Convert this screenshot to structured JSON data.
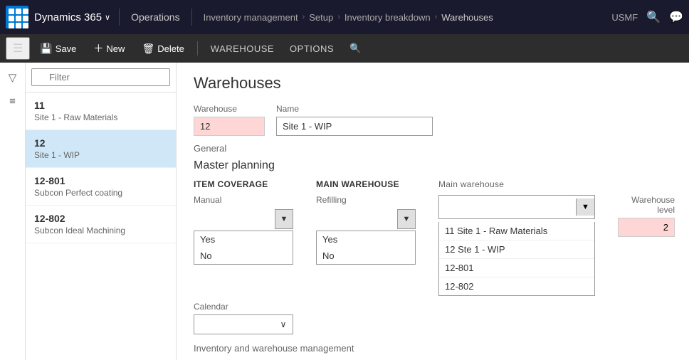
{
  "topnav": {
    "brand": "Dynamics 365",
    "brand_chevron": "∨",
    "module": "Operations",
    "breadcrumbs": [
      {
        "label": "Inventory management"
      },
      {
        "label": "Setup"
      },
      {
        "label": "Inventory breakdown"
      },
      {
        "label": "Warehouses"
      }
    ],
    "region": "USMF",
    "search_placeholder": "Search"
  },
  "toolbar": {
    "save_label": "Save",
    "new_label": "New",
    "delete_label": "Delete",
    "warehouse_label": "WAREHOUSE",
    "options_label": "OPTIONS"
  },
  "sidebar": {
    "filter_placeholder": "Filter",
    "items": [
      {
        "id": "11",
        "name": "Site 1 - Raw Materials",
        "active": false
      },
      {
        "id": "12",
        "name": "Site 1 - WIP",
        "active": true
      },
      {
        "id": "12-801",
        "name": "Subcon Perfect coating",
        "active": false
      },
      {
        "id": "12-802",
        "name": "Subcon Ideal Machining",
        "active": false
      }
    ]
  },
  "form": {
    "page_title": "Warehouses",
    "warehouse_label": "Warehouse",
    "warehouse_value": "12",
    "name_label": "Name",
    "name_value": "Site 1 - WIP",
    "general_label": "General",
    "master_planning_label": "Master planning",
    "item_coverage_label": "ITEM COVERAGE",
    "main_warehouse_col_label": "MAIN WAREHOUSE",
    "main_warehouse_label": "Main warehouse",
    "manual_label": "Manual",
    "refilling_label": "Refilling",
    "yes_label": "Yes",
    "no_label": "No",
    "yes2_label": "Yes",
    "no2_label": "No",
    "calendar_label": "Calendar",
    "warehouse_level_label": "Warehouse level",
    "warehouse_level_value": "2",
    "main_warehouse_options": [
      {
        "label": "11 Site 1 - Raw Materials"
      },
      {
        "label": "12 Ste 1 - WIP"
      },
      {
        "label": "12-801"
      },
      {
        "label": "12-802"
      }
    ],
    "inventory_label": "Inventory and warehouse management"
  }
}
